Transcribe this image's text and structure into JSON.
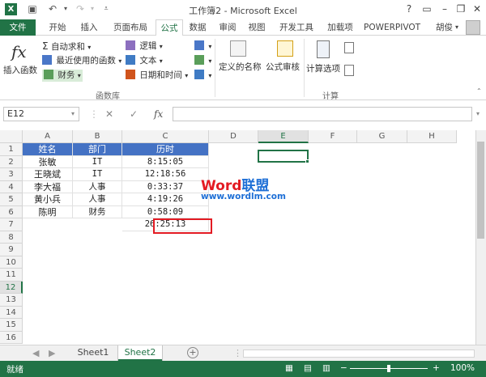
{
  "window": {
    "title": "工作簿2 - Microsoft Excel"
  },
  "quick_access": [
    "save-icon",
    "undo-icon",
    "redo-icon",
    "customize-icon"
  ],
  "window_controls": [
    "help-icon",
    "ribbon-options-icon",
    "minimize-icon",
    "restore-icon",
    "close-icon"
  ],
  "tabs": [
    {
      "label": "文件"
    },
    {
      "label": "开始"
    },
    {
      "label": "插入"
    },
    {
      "label": "页面布局"
    },
    {
      "label": "公式"
    },
    {
      "label": "数据"
    },
    {
      "label": "审阅"
    },
    {
      "label": "视图"
    },
    {
      "label": "开发工具"
    },
    {
      "label": "加载项"
    },
    {
      "label": "POWERPIVOT"
    }
  ],
  "user": {
    "name": "胡俊"
  },
  "ribbon": {
    "insert_function": "插入函数",
    "fx_symbol": "fx",
    "autosum": "自动求和",
    "recent": "最近使用的函数",
    "financial": "财务",
    "logical": "逻辑",
    "text": "文本",
    "datetime": "日期和时间",
    "group_library": "函数库",
    "defined_names": "定义的名称",
    "formula_audit": "公式审核",
    "calc_options": "计算选项",
    "group_calc": "计算"
  },
  "formula_bar": {
    "cell_ref": "E12",
    "fx": "fx",
    "cancel": "✕",
    "enter": "✓"
  },
  "columns": [
    "A",
    "B",
    "C",
    "D",
    "E",
    "F",
    "G",
    "H"
  ],
  "rows": [
    "1",
    "2",
    "3",
    "4",
    "5",
    "6",
    "7",
    "8",
    "9",
    "10",
    "11",
    "12",
    "13",
    "14",
    "15",
    "16"
  ],
  "table": {
    "header": [
      "姓名",
      "部门",
      "历时"
    ],
    "rows": [
      [
        "张敏",
        "IT",
        "8:15:05"
      ],
      [
        "王晓斌",
        "IT",
        "12:18:56"
      ],
      [
        "李大福",
        "人事",
        "0:33:37"
      ],
      [
        "黄小兵",
        "人事",
        "4:19:26"
      ],
      [
        "陈明",
        "财务",
        "0:58:09"
      ]
    ],
    "total": "26:25:13"
  },
  "watermark": {
    "word": "Word",
    "lianmeng": "联盟",
    "url": "www.wordlm.com"
  },
  "sheets": [
    {
      "label": "Sheet1"
    },
    {
      "label": "Sheet2"
    }
  ],
  "status": {
    "ready": "就绪",
    "zoom": "100%"
  },
  "colors": {
    "accent": "#217346",
    "header_fill": "#4472c4",
    "highlight": "#e31b23"
  }
}
